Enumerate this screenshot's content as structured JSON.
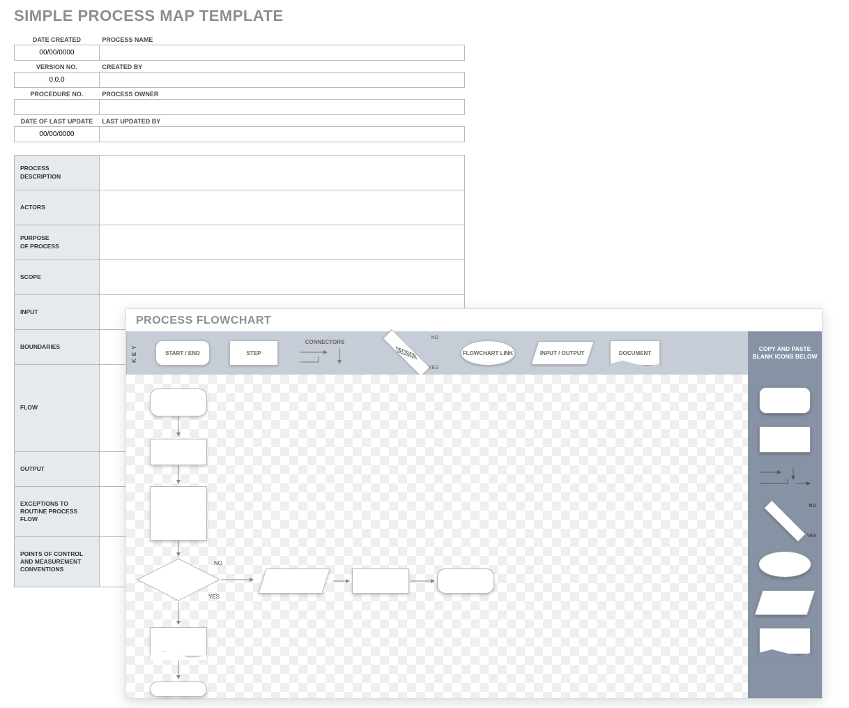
{
  "title": "SIMPLE PROCESS MAP TEMPLATE",
  "meta": {
    "rows": [
      {
        "leftLabel": "DATE CREATED",
        "leftValue": "00/00/0000",
        "rightLabel": "PROCESS NAME",
        "rightValue": ""
      },
      {
        "leftLabel": "VERSION NO.",
        "leftValue": "0.0.0",
        "rightLabel": "CREATED BY",
        "rightValue": ""
      },
      {
        "leftLabel": "PROCEDURE NO.",
        "leftValue": "",
        "rightLabel": "PROCESS OWNER",
        "rightValue": ""
      },
      {
        "leftLabel": "DATE OF LAST UPDATE",
        "leftValue": "00/00/0000",
        "rightLabel": "LAST UPDATED BY",
        "rightValue": ""
      }
    ]
  },
  "desc": {
    "rows": [
      {
        "label": "PROCESS\nDESCRIPTION",
        "size": "h"
      },
      {
        "label": "ACTORS",
        "size": "h"
      },
      {
        "label": "PURPOSE\nOF PROCESS",
        "size": "h"
      },
      {
        "label": "SCOPE",
        "size": "h"
      },
      {
        "label": "INPUT",
        "size": "h"
      },
      {
        "label": "BOUNDARIES",
        "size": "h"
      },
      {
        "label": "FLOW",
        "size": "lg"
      },
      {
        "label": "OUTPUT",
        "size": "h"
      },
      {
        "label": "EXCEPTIONS TO\nROUTINE PROCESS FLOW",
        "size": "md"
      },
      {
        "label": "POINTS OF CONTROL\nAND MEASUREMENT\nCONVENTIONS",
        "size": "md"
      }
    ]
  },
  "flowchart": {
    "title": "PROCESS FLOWCHART",
    "keyLabel": "KEY",
    "pasteLabel": "COPY AND PASTE BLANK ICONS BELOW",
    "legend": {
      "startEnd": "START / END",
      "step": "STEP",
      "connectors": "CONNECTORS",
      "decision": "DECISION",
      "no": "NO",
      "yes": "YES",
      "flowchartLink": "FLOWCHART LINK",
      "inputOutput": "INPUT / OUTPUT",
      "document": "DOCUMENT"
    },
    "paletteLabels": {
      "no": "NO",
      "yes": "YES"
    },
    "canvasLabels": {
      "no": "NO",
      "yes": "YES"
    }
  }
}
